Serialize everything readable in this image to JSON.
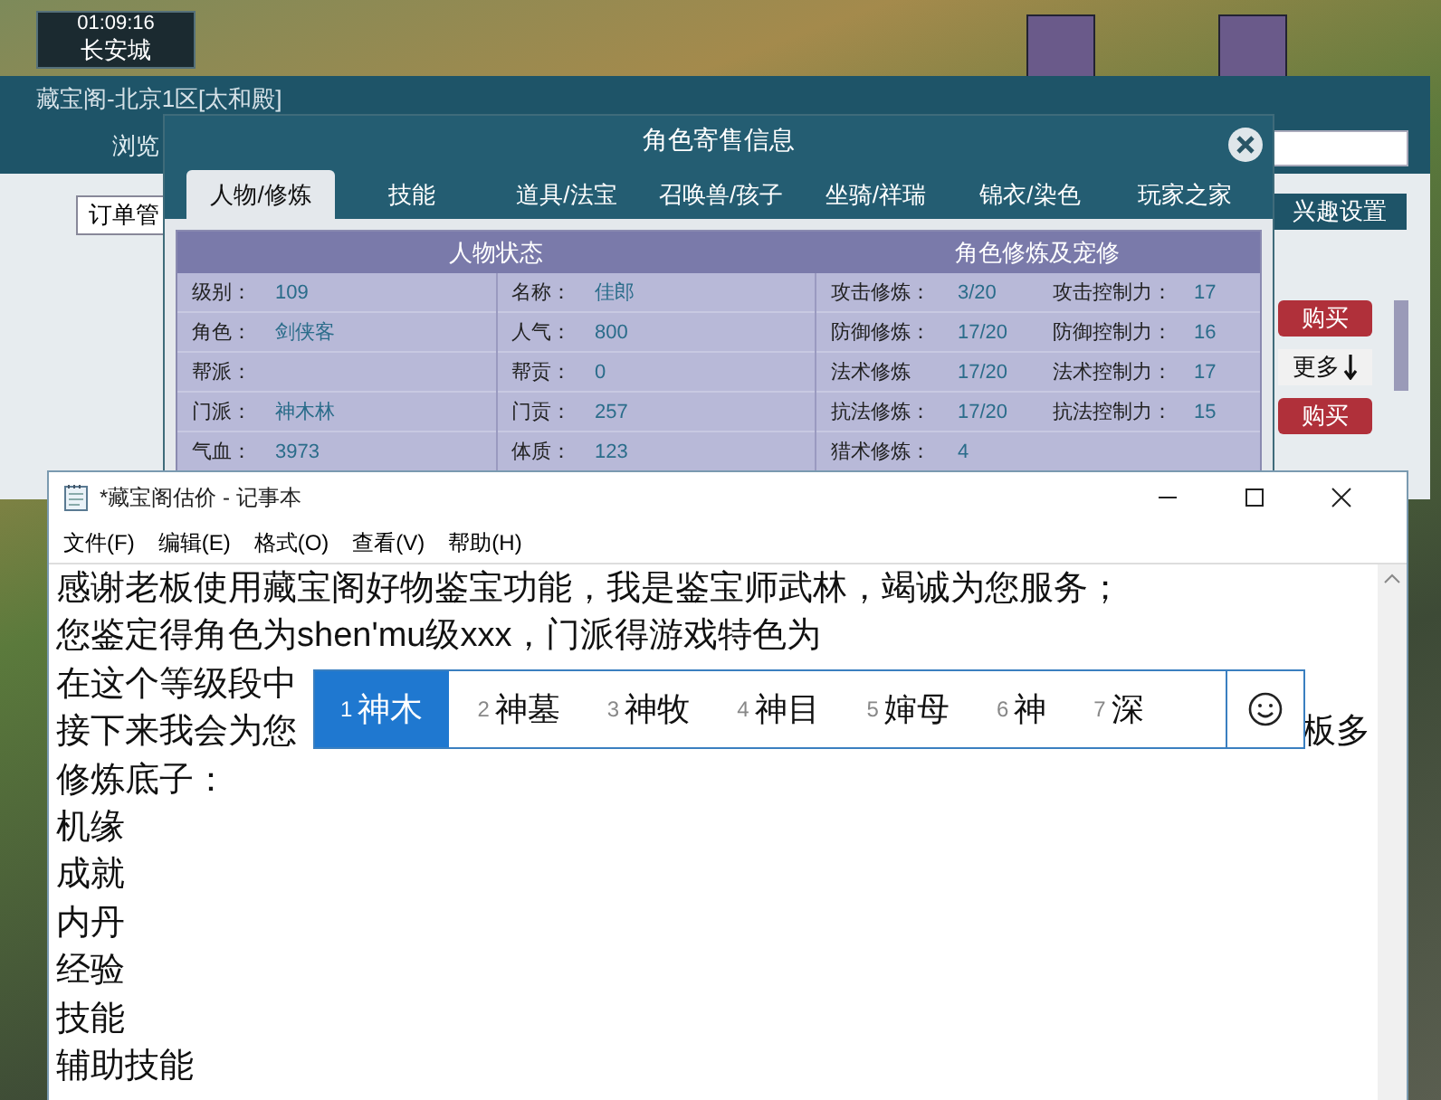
{
  "hud": {
    "time": "01:09:16",
    "location": "长安城"
  },
  "shop_window": {
    "title": "藏宝阁-北京1区[太和殿]",
    "browse_tab": "浏览",
    "order_tab": "订单管",
    "interest_button": "兴趣设置",
    "buy_buttons": [
      "购买",
      "购买"
    ],
    "more_button": "更多"
  },
  "dialog": {
    "title": "角色寄售信息",
    "tabs": [
      {
        "label": "人物/修炼",
        "selected": true
      },
      {
        "label": "技能",
        "selected": false
      },
      {
        "label": "道具/法宝",
        "selected": false
      },
      {
        "label": "召唤兽/孩子",
        "selected": false
      },
      {
        "label": "坐骑/祥瑞",
        "selected": false
      },
      {
        "label": "锦衣/染色",
        "selected": false
      },
      {
        "label": "玩家之家",
        "selected": false
      }
    ],
    "status_title": "人物状态",
    "cultivation_title": "角色修炼及宠修",
    "status_columns": [
      [
        {
          "label": "级别：",
          "value": "109"
        },
        {
          "label": "角色：",
          "value": "剑侠客"
        },
        {
          "label": "帮派："
        },
        {
          "label": "门派：",
          "value": "神木林"
        },
        {
          "label": "气血：",
          "value": "3973"
        }
      ],
      [
        {
          "label": "名称：",
          "value": "佳郎"
        },
        {
          "label": "人气：",
          "value": "800"
        },
        {
          "label": "帮贡：",
          "value": "0"
        },
        {
          "label": "门贡：",
          "value": "257"
        },
        {
          "label": "体质：",
          "value": "123"
        }
      ]
    ],
    "cultivation_columns": [
      [
        {
          "label": "攻击修炼：",
          "value": "3/20"
        },
        {
          "label": "防御修炼：",
          "value": "17/20"
        },
        {
          "label": "法术修炼",
          "value": "17/20"
        },
        {
          "label": "抗法修炼：",
          "value": "17/20"
        },
        {
          "label": "猎术修炼：",
          "value": "4"
        }
      ],
      [
        {
          "label": "攻击控制力：",
          "value": "17"
        },
        {
          "label": "防御控制力：",
          "value": "16"
        },
        {
          "label": "法术控制力：",
          "value": "17"
        },
        {
          "label": "抗法控制力：",
          "value": "15"
        }
      ]
    ]
  },
  "notepad": {
    "title": "*藏宝阁估价 - 记事本",
    "menu": [
      "文件(F)",
      "编辑(E)",
      "格式(O)",
      "查看(V)",
      "帮助(H)"
    ],
    "lines": [
      {
        "text": "感谢老板使用藏宝阁好物鉴宝功能，我是鉴宝师武林，竭诚为您服务；"
      },
      {
        "text": "您鉴定得角色为shen'mu级xxx，门派得游戏特色为"
      },
      {
        "text": "在这个等级段中"
      },
      {
        "text": "接下来我会为您",
        "tail": "板多"
      },
      {
        "text": "修炼底子："
      },
      {
        "text": "机缘"
      },
      {
        "text": "成就"
      },
      {
        "text": "内丹"
      },
      {
        "text": "经验"
      },
      {
        "text": "技能"
      },
      {
        "text": "辅助技能"
      }
    ]
  },
  "ime": {
    "candidates": [
      {
        "index": "1",
        "text": "神木",
        "selected": true
      },
      {
        "index": "2",
        "text": "神墓",
        "selected": false
      },
      {
        "index": "3",
        "text": "神牧",
        "selected": false
      },
      {
        "index": "4",
        "text": "神目",
        "selected": false
      },
      {
        "index": "5",
        "text": "婶母",
        "selected": false
      },
      {
        "index": "6",
        "text": "神",
        "selected": false
      },
      {
        "index": "7",
        "text": "深",
        "selected": false
      }
    ]
  }
}
